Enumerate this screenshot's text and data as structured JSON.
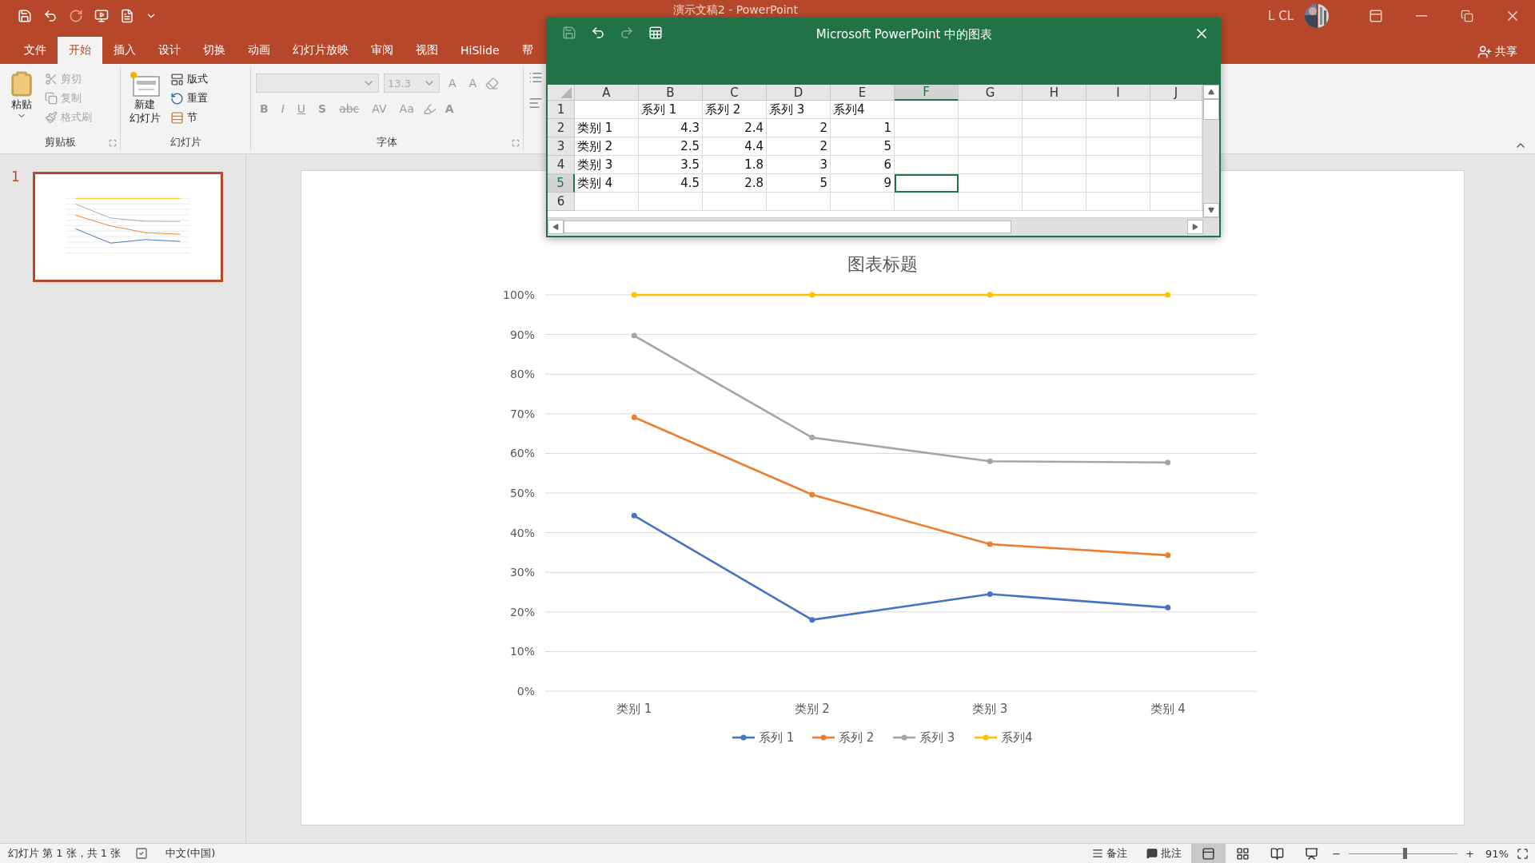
{
  "app": {
    "title": "演示文稿2  -  PowerPoint",
    "user": "L CL",
    "share": "共享"
  },
  "ribbon_tabs": [
    {
      "label": "文件",
      "selected": false
    },
    {
      "label": "开始",
      "selected": true
    },
    {
      "label": "插入",
      "selected": false
    },
    {
      "label": "设计",
      "selected": false
    },
    {
      "label": "切换",
      "selected": false
    },
    {
      "label": "动画",
      "selected": false
    },
    {
      "label": "幻灯片放映",
      "selected": false
    },
    {
      "label": "审阅",
      "selected": false
    },
    {
      "label": "视图",
      "selected": false
    },
    {
      "label": "HiSlide",
      "selected": false
    },
    {
      "label": "帮",
      "selected": false
    }
  ],
  "ribbon": {
    "clipboard": {
      "label": "剪贴板",
      "paste": "粘贴",
      "items": [
        {
          "kind": "cut",
          "label": "剪切",
          "disabled": true
        },
        {
          "kind": "copy",
          "label": "复制",
          "disabled": true
        },
        {
          "kind": "painter",
          "label": "格式刷",
          "disabled": true
        }
      ]
    },
    "slides": {
      "label": "幻灯片",
      "new_slide": [
        "新建",
        "幻灯片"
      ],
      "items": [
        {
          "kind": "layout",
          "label": "版式"
        },
        {
          "kind": "reset",
          "label": "重置"
        },
        {
          "kind": "section",
          "label": "节"
        }
      ]
    },
    "font": {
      "label": "字体",
      "size": "13.3",
      "grow": "A",
      "shrink": "A",
      "styles": [
        "B",
        "I",
        "U",
        "S",
        "abc",
        "AV",
        "Aa"
      ],
      "font_color_button": "A"
    }
  },
  "slides_panel": [
    {
      "number": "1",
      "selected": true
    }
  ],
  "chart_sheet": {
    "title": "Microsoft PowerPoint 中的图表",
    "columns": [
      {
        "label": "A",
        "selected": false
      },
      {
        "label": "B",
        "selected": false
      },
      {
        "label": "C",
        "selected": false
      },
      {
        "label": "D",
        "selected": false
      },
      {
        "label": "E",
        "selected": false
      },
      {
        "label": "F",
        "selected": true
      },
      {
        "label": "G",
        "selected": false
      },
      {
        "label": "H",
        "selected": false
      },
      {
        "label": "I",
        "selected": false
      },
      {
        "label": "J",
        "selected": false
      }
    ],
    "rows": [
      {
        "number": "1",
        "selected": false,
        "cells": [
          null,
          "系列 1",
          "系列 2",
          "系列 3",
          "系列4"
        ]
      },
      {
        "number": "2",
        "selected": false,
        "cells": [
          "类别 1",
          "4.3",
          "2.4",
          "2",
          "1"
        ]
      },
      {
        "number": "3",
        "selected": false,
        "cells": [
          "类别 2",
          "2.5",
          "4.4",
          "2",
          "5"
        ]
      },
      {
        "number": "4",
        "selected": false,
        "cells": [
          "类别 3",
          "3.5",
          "1.8",
          "3",
          "6"
        ]
      },
      {
        "number": "5",
        "selected": true,
        "cells": [
          "类别 4",
          "4.5",
          "2.8",
          "5",
          "9"
        ]
      },
      {
        "number": "6",
        "selected": false,
        "cells": []
      }
    ]
  },
  "slide_chart": {
    "chart_data": {
      "type": "line",
      "title": "图表标题",
      "categories": [
        "类别 1",
        "类别 2",
        "类别 3",
        "类别 4"
      ],
      "series": [
        {
          "name": "系列 1",
          "color": "#4472c4",
          "marker": "circle",
          "values": [
            44.3,
            18.0,
            24.5,
            21.1
          ]
        },
        {
          "name": "系列 2",
          "color": "#ed7d31",
          "marker": "circle",
          "values": [
            69.1,
            49.6,
            37.1,
            34.3
          ]
        },
        {
          "name": "系列 3",
          "color": "#a5a5a5",
          "marker": "circle",
          "values": [
            89.7,
            64.0,
            58.0,
            57.7
          ]
        },
        {
          "name": "系列4",
          "color": "#ffc000",
          "marker": "circle",
          "values": [
            100,
            100,
            100,
            100
          ]
        }
      ],
      "ylim": [
        0,
        100
      ],
      "grid": true,
      "legend": true,
      "yticks": [
        {
          "value": 0,
          "label": "0%"
        },
        {
          "value": 10,
          "label": "10%"
        },
        {
          "value": 20,
          "label": "20%"
        },
        {
          "value": 30,
          "label": "30%"
        },
        {
          "value": 40,
          "label": "40%"
        },
        {
          "value": 50,
          "label": "50%"
        },
        {
          "value": 60,
          "label": "60%"
        },
        {
          "value": 70,
          "label": "70%"
        },
        {
          "value": 80,
          "label": "80%"
        },
        {
          "value": 90,
          "label": "90%"
        },
        {
          "value": 100,
          "label": "100%"
        }
      ]
    }
  },
  "status_bar": {
    "slide_info": "幻灯片 第 1 张，共 1 张",
    "language": "中文(中国)",
    "notes": "备注",
    "comments": "批注",
    "views": [
      {
        "kind": "normal",
        "selected": true
      },
      {
        "kind": "sorter",
        "selected": false
      },
      {
        "kind": "reading",
        "selected": false
      },
      {
        "kind": "slideshow",
        "selected": false
      }
    ],
    "zoom": {
      "minus": "−",
      "plus": "+",
      "level": 0.51,
      "reading": "91%"
    }
  }
}
